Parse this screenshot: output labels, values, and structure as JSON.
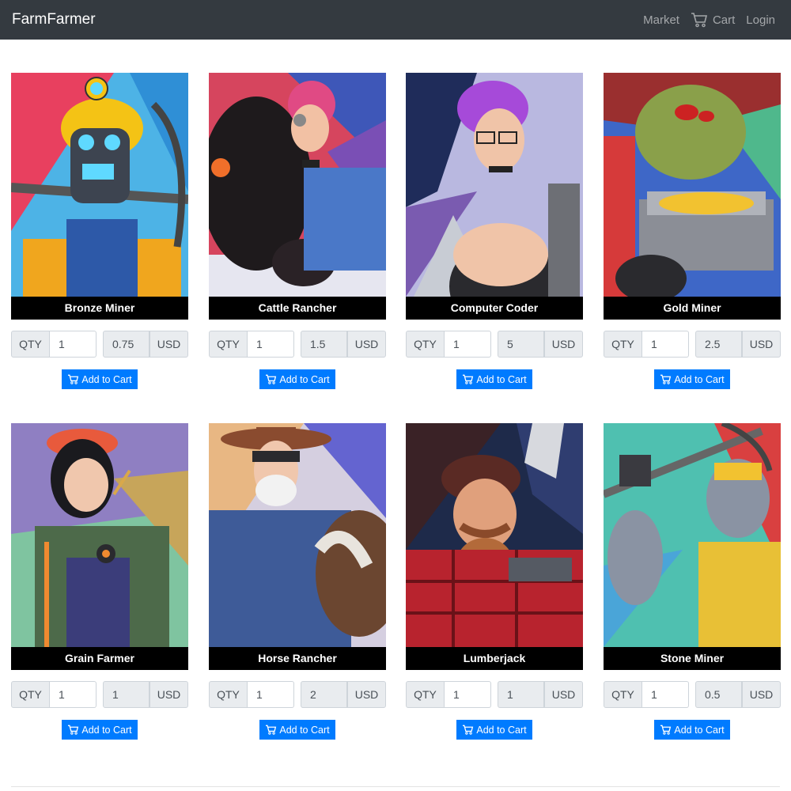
{
  "navbar": {
    "brand": "FarmFarmer",
    "market_label": "Market",
    "cart_label": "Cart",
    "login_label": "Login",
    "cart_icon": "cart-icon"
  },
  "products": [
    {
      "name": "Bronze Miner",
      "qty_label": "QTY",
      "qty": "1",
      "price": "0.75",
      "currency": "USD",
      "button": "Add to Cart"
    },
    {
      "name": "Cattle Rancher",
      "qty_label": "QTY",
      "qty": "1",
      "price": "1.5",
      "currency": "USD",
      "button": "Add to Cart"
    },
    {
      "name": "Computer Coder",
      "qty_label": "QTY",
      "qty": "1",
      "price": "5",
      "currency": "USD",
      "button": "Add to Cart"
    },
    {
      "name": "Gold Miner",
      "qty_label": "QTY",
      "qty": "1",
      "price": "2.5",
      "currency": "USD",
      "button": "Add to Cart"
    },
    {
      "name": "Grain Farmer",
      "qty_label": "QTY",
      "qty": "1",
      "price": "1",
      "currency": "USD",
      "button": "Add to Cart"
    },
    {
      "name": "Horse Rancher",
      "qty_label": "QTY",
      "qty": "1",
      "price": "2",
      "currency": "USD",
      "button": "Add to Cart"
    },
    {
      "name": "Lumberjack",
      "qty_label": "QTY",
      "qty": "1",
      "price": "1",
      "currency": "USD",
      "button": "Add to Cart"
    },
    {
      "name": "Stone Miner",
      "qty_label": "QTY",
      "qty": "1",
      "price": "0.5",
      "currency": "USD",
      "button": "Add to Cart"
    }
  ],
  "colors": {
    "navbar_bg": "#343a40",
    "button_bg": "#007bff",
    "title_bar_bg": "#000000"
  }
}
